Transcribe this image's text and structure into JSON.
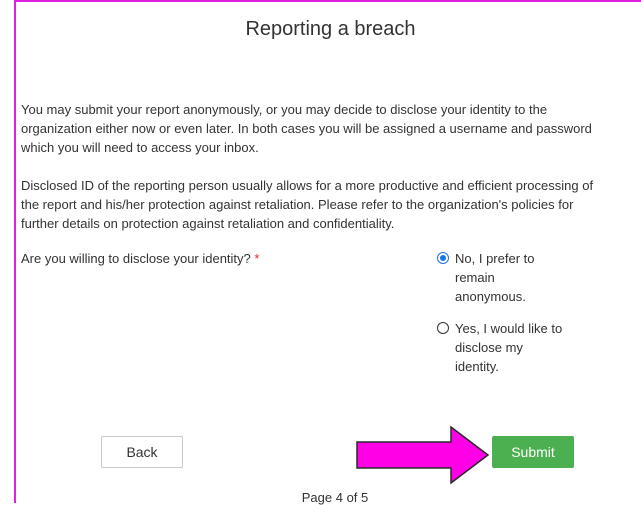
{
  "page": {
    "title": "Reporting a breach",
    "paragraph1_line1": "You may submit your report anonymously, or you may decide to disclose your identity to the",
    "paragraph1_line2": "organization either now or even later. In both cases you will be assigned a username and password",
    "paragraph1_line3": "which you will need to access your inbox.",
    "paragraph2_line1": "Disclosed ID of the reporting person usually allows for a more productive and efficient processing of",
    "paragraph2_line2": "the report and his/her protection against retaliation. Please refer to the organization's policies for",
    "paragraph2_line3": "further details on protection against retaliation and confidentiality."
  },
  "question": {
    "label": "Are you willing to disclose your identity?",
    "required_marker": "*",
    "options": [
      {
        "label": "No, I prefer to remain anonymous.",
        "selected": true
      },
      {
        "label": "Yes, I would like to disclose my identity.",
        "selected": false
      }
    ]
  },
  "buttons": {
    "back": "Back",
    "submit": "Submit"
  },
  "pager": {
    "text": "Page 4 of 5"
  },
  "colors": {
    "frame": "#e020e0",
    "arrow": "#ff00e6",
    "submit": "#4caf50",
    "radio_selected": "#1a73e8"
  },
  "annotation": {
    "icon": "arrow-right-icon"
  }
}
